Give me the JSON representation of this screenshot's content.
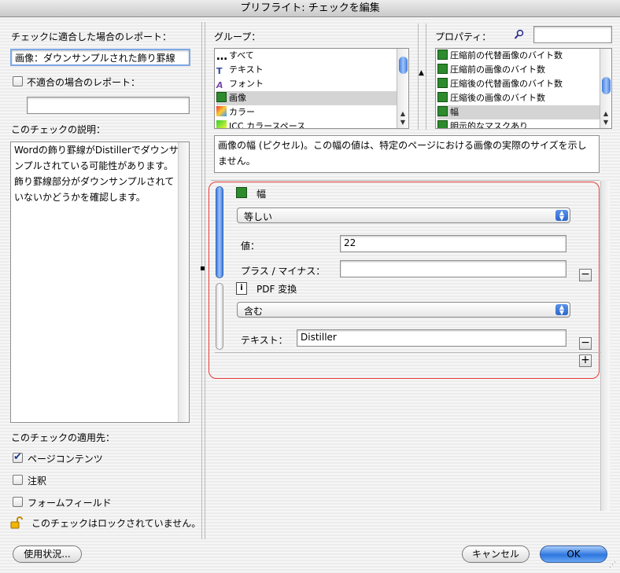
{
  "window": {
    "title": "プリフライト: チェックを編集"
  },
  "left": {
    "report_match_label": "チェックに適合した場合のレポート：",
    "report_match_value": "画像：ダウンサンプルされた飾り罫線",
    "report_nomatch_label": "不適合の場合のレポート：",
    "report_nomatch_value": "",
    "description_label": "このチェックの説明：",
    "description_text": "Wordの飾り罫線がDistillerでダウンサンプルされている可能性があります。飾り罫線部分がダウンサンプルされていないかどうかを確認します。",
    "applies_label": "このチェックの適用先：",
    "applies_items": [
      {
        "label": "ページコンテンツ",
        "checked": true
      },
      {
        "label": "注釈",
        "checked": false
      },
      {
        "label": "フォームフィールド",
        "checked": false
      }
    ],
    "lock_status": "このチェックはロックされていません。",
    "usage_button": "使用状況..."
  },
  "groups": {
    "label": "グループ：",
    "items": [
      {
        "label": "すべて",
        "icon": "dots-icon"
      },
      {
        "label": "テキスト",
        "icon": "text-icon"
      },
      {
        "label": "フォント",
        "icon": "font-icon"
      },
      {
        "label": "画像",
        "icon": "image-icon",
        "selected": true
      },
      {
        "label": "カラー",
        "icon": "color-icon"
      },
      {
        "label": "ICC カラースペース",
        "icon": "icc-icon"
      }
    ]
  },
  "properties": {
    "label": "プロパティ：",
    "search_value": "",
    "items": [
      {
        "label": "圧縮前の代替画像のバイト数"
      },
      {
        "label": "圧縮前の画像のバイト数"
      },
      {
        "label": "圧縮後の代替画像のバイト数"
      },
      {
        "label": "圧縮後の画像のバイト数"
      },
      {
        "label": "幅",
        "selected": true
      },
      {
        "label": "明示的なマスクあり"
      }
    ]
  },
  "property_description": "画像の幅 (ピクセル)。この幅の値は、特定のページにおける画像の実際のサイズを示しません。",
  "conditions": [
    {
      "title": "幅",
      "operator": "等しい",
      "fields": [
        {
          "label": "値：",
          "value": "22"
        },
        {
          "label": "プラス / マイナス：",
          "value": ""
        }
      ]
    },
    {
      "title": "PDF 変換",
      "operator": "含む",
      "fields": [
        {
          "label": "テキスト：",
          "value": "Distiller"
        }
      ]
    }
  ],
  "buttons": {
    "cancel": "キャンセル",
    "ok": "OK",
    "minus": "−",
    "plus": "+"
  },
  "colors": {
    "highlight_border": "#e83a3a",
    "accent": "#2e77e0"
  }
}
